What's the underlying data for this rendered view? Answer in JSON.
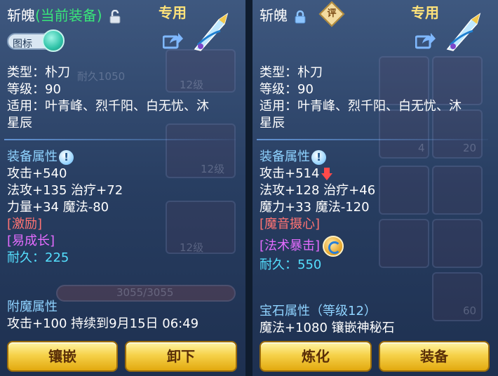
{
  "left": {
    "title_name": "斩魄",
    "title_status": "(当前装备)",
    "tag_exclusive": "专用",
    "icon_toggle_label": "图标",
    "type": "类型：朴刀",
    "level": "等级：90",
    "applicable_line1": "适用：叶青峰、烈千阳、白无忧、沐",
    "applicable_line2": "星辰",
    "equip_attr_header": "装备属性",
    "attack": "攻击+540",
    "magic_attack_heal": "法攻+135 治疗+72",
    "strength_mana": "力量+34 魔法-80",
    "special1": "[激励]",
    "special2": "[易成长]",
    "durability_label": "耐久：",
    "durability_value": "225",
    "enchant_header": "附魔属性",
    "enchant_line": "攻击+100 持续到9月15日 06:49",
    "button_left": "镶嵌",
    "button_right": "卸下",
    "bg_hint_1": "耐久1050",
    "bg_hint_2": "12级",
    "bg_hint_3": "12级",
    "bg_hint_4": "12级",
    "bg_hint_5": "3055/3055"
  },
  "right": {
    "title_name": "斩魄",
    "eval_badge": "评",
    "tag_exclusive": "专用",
    "type": "类型：朴刀",
    "level": "等级：90",
    "applicable_line1": "适用：叶青峰、烈千阳、白无忧、沐",
    "applicable_line2": "星辰",
    "equip_attr_header": "装备属性",
    "attack": "攻击+514",
    "magic_attack_heal": "法攻+128 治疗+46",
    "power_mana": "魔力+33 魔法-120",
    "special1": "[魔音摄心]",
    "special2": "[法术暴击]",
    "durability_label": "耐久：",
    "durability_value": "550",
    "gem_header": "宝石属性（等级12）",
    "gem_line": "魔法+1080 镶嵌神秘石",
    "button_left": "炼化",
    "button_right": "装备",
    "bg_hint_1": "4",
    "bg_hint_2": "20",
    "bg_hint_3": "60"
  },
  "colors": {
    "accent_green": "#39e67a",
    "stat_cyan": "#55e0ff",
    "special_red": "#ff7373",
    "special_purple": "#e46cff",
    "button_gold": "#f6d24a"
  },
  "icons": [
    "lock-open-icon",
    "lock-closed-icon",
    "share-icon",
    "weapon-icon",
    "info-icon",
    "down-arrow-icon",
    "refresh-icon"
  ]
}
